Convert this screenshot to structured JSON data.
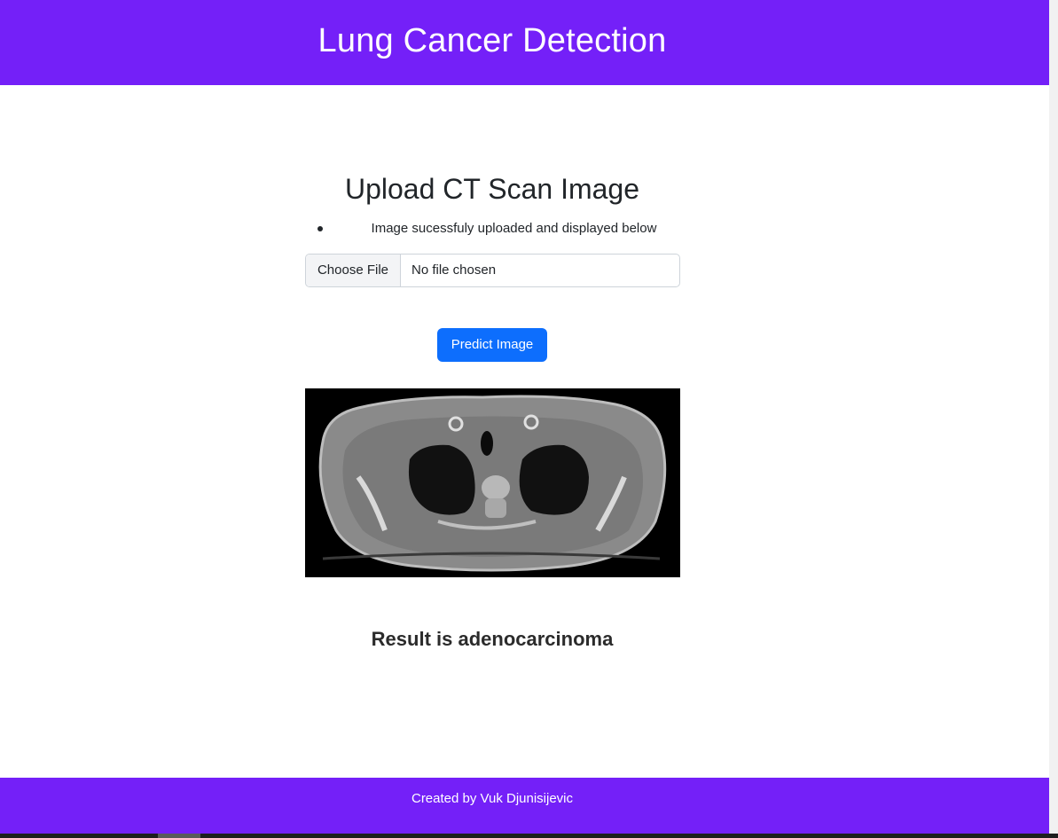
{
  "header": {
    "title": "Lung Cancer Detection",
    "bg_color": "#7420f8"
  },
  "upload": {
    "title": "Upload CT Scan Image",
    "messages": [
      "Image sucessfuly uploaded and displayed below"
    ],
    "file_button_label": "Choose File",
    "file_status": "No file chosen",
    "predict_button_label": "Predict Image",
    "predict_button_color": "#0d6efd"
  },
  "result": {
    "text": "Result is adenocarcinoma"
  },
  "footer": {
    "text": "Created by Vuk Djunisijevic"
  }
}
